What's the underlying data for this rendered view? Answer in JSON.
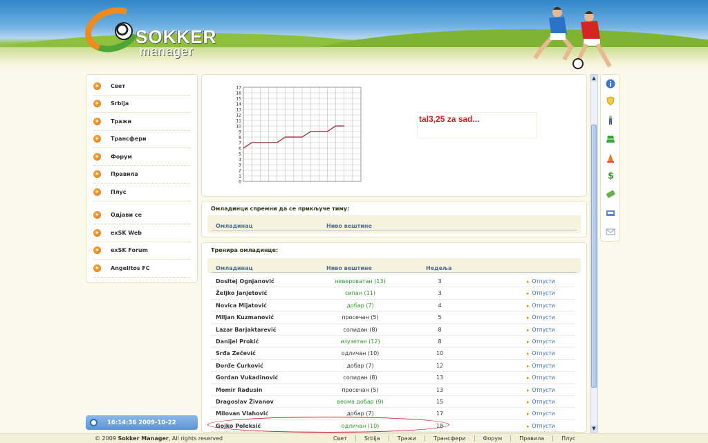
{
  "header": {
    "logo_word1": "SOKKER",
    "logo_word2": "manager"
  },
  "nav": {
    "items": [
      "Свет",
      "Srbija",
      "Тражи",
      "Трансфери",
      "Форум",
      "Правила",
      "Плус"
    ],
    "items2": [
      "Одјави се",
      "exSK Web",
      "exSK Forum",
      "Angelitos FC"
    ]
  },
  "clock": {
    "text": "16:14:36  2009-10-22"
  },
  "chart_note": "tal3,25 za sad...",
  "chart_data": {
    "type": "line",
    "x": [
      0,
      1,
      2,
      3,
      4,
      5,
      6,
      7,
      8,
      9,
      10,
      11,
      12
    ],
    "values": [
      6,
      7,
      7,
      7,
      7,
      8,
      8,
      8,
      9,
      9,
      9,
      10,
      10
    ],
    "ylim": [
      0,
      17
    ],
    "yticks": [
      "0",
      "1",
      "2",
      "3",
      "4",
      "5",
      "6",
      "7",
      "8",
      "9",
      "10",
      "11",
      "12",
      "13",
      "14",
      "15",
      "16",
      "17"
    ],
    "grid": true,
    "line_color": "#a0464a"
  },
  "ready": {
    "title": "Омладинци спремни да се прикључе тиму:",
    "col_player": "Омладинац",
    "col_skill": "Ниво вештине"
  },
  "training": {
    "title": "Тренира омладинце:",
    "col_player": "Омладинац",
    "col_skill": "Ниво вештине",
    "col_weeks": "Недеља",
    "action": "Отпусти",
    "rows": [
      {
        "name": "Dositej Ognjanović",
        "skill": "невероватан (13)",
        "weeks": "3",
        "green": true
      },
      {
        "name": "Željko Janjetović",
        "skill": "сипан (11)",
        "weeks": "3",
        "green": true
      },
      {
        "name": "Novica Mijatović",
        "skill": "добар (7)",
        "weeks": "4",
        "green": true
      },
      {
        "name": "Miljan Kuzmanović",
        "skill": "просечан (5)",
        "weeks": "5",
        "green": false
      },
      {
        "name": "Lazar Barjaktarević",
        "skill": "солидан (8)",
        "weeks": "8",
        "green": false
      },
      {
        "name": "Danijel Prokić",
        "skill": "изузетан (12)",
        "weeks": "8",
        "green": true
      },
      {
        "name": "Srđa Zečević",
        "skill": "одличан (10)",
        "weeks": "10",
        "green": false
      },
      {
        "name": "Đorđe Ćurković",
        "skill": "добар (7)",
        "weeks": "12",
        "green": false
      },
      {
        "name": "Gordan Vukadinović",
        "skill": "солидан (8)",
        "weeks": "13",
        "green": false
      },
      {
        "name": "Momir Radusin",
        "skill": "просечан (5)",
        "weeks": "13",
        "green": false
      },
      {
        "name": "Dragoslav Živanov",
        "skill": "веома добар (9)",
        "weeks": "15",
        "green": true
      },
      {
        "name": "Milovan Vlahović",
        "skill": "добар (7)",
        "weeks": "17",
        "green": false
      },
      {
        "name": "Gojko Poleksić",
        "skill": "одличан (10)",
        "weeks": "18",
        "green": true
      }
    ]
  },
  "footer": {
    "copyright_prefix": "© 2009",
    "copyright_brand": "Sokker Manager",
    "copyright_suffix": ", All rights reserved",
    "links": [
      "Свет",
      "Srbija",
      "Тражи",
      "Трансфери",
      "Форум",
      "Правила",
      "Плус"
    ]
  },
  "tools": [
    "info-icon",
    "shield-icon",
    "player-icon",
    "pitch-icon",
    "cone-icon",
    "dollar-icon",
    "money-icon",
    "board-icon",
    "mail-icon"
  ]
}
